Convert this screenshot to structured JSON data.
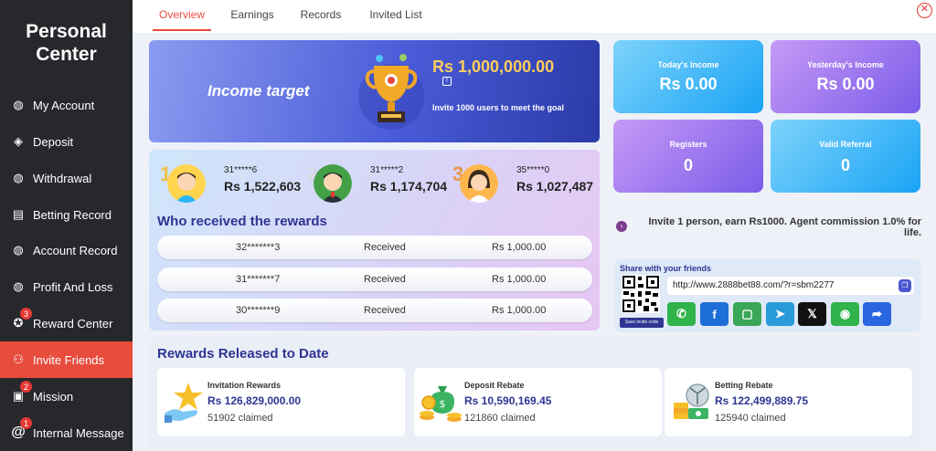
{
  "sidebar": {
    "title_line1": "Personal",
    "title_line2": "Center",
    "items": [
      {
        "label": "My Account"
      },
      {
        "label": "Deposit"
      },
      {
        "label": "Withdrawal"
      },
      {
        "label": "Betting Record"
      },
      {
        "label": "Account Record"
      },
      {
        "label": "Profit And Loss"
      },
      {
        "label": "Reward Center",
        "badge": "3"
      },
      {
        "label": "Invite Friends"
      },
      {
        "label": "Mission",
        "badge": "2"
      },
      {
        "label": "Internal Message",
        "badge": "1"
      }
    ]
  },
  "tabs": [
    "Overview",
    "Earnings",
    "Records",
    "Invited List"
  ],
  "income_target": {
    "label": "Income target",
    "amount": "Rs  1,000,000.00",
    "badge": "!",
    "description": "Invite 1000 users to meet the goal"
  },
  "stats": {
    "today": {
      "label": "Today's Income",
      "value": "Rs  0.00"
    },
    "yesterday": {
      "label": "Yesterday's Income",
      "value": "Rs  0.00"
    },
    "registers": {
      "label": "Registers",
      "value": "0"
    },
    "valid_referral": {
      "label": "Valid Referral",
      "value": "0"
    }
  },
  "leaderboard": [
    {
      "rank": "1",
      "user": "31*****6",
      "amount": "Rs 1,522,603"
    },
    {
      "rank": "2",
      "user": "31*****2",
      "amount": "Rs 1,174,704"
    },
    {
      "rank": "3",
      "user": "35*****0",
      "amount": "Rs 1,027,487"
    }
  ],
  "who_received": {
    "title": "Who received the rewards",
    "rows": [
      {
        "user": "32*******3",
        "status": "Received",
        "amount": "Rs  1,000.00"
      },
      {
        "user": "31*******7",
        "status": "Received",
        "amount": "Rs  1,000.00"
      },
      {
        "user": "30*******9",
        "status": "Received",
        "amount": "Rs  1,000.00"
      }
    ]
  },
  "invite_text": "Invite 1 person, earn Rs1000. Agent commission 1.0% for life.",
  "share": {
    "title": "Share with your friends",
    "url": "http://www.2888bet88.com/?r=sbm2277",
    "qr_button": "Save invite code",
    "socials": [
      {
        "name": "whatsapp-icon",
        "glyph": "✆",
        "color": "#2fb34a"
      },
      {
        "name": "facebook-icon",
        "glyph": "f",
        "color": "#1e6ed8"
      },
      {
        "name": "sms-icon",
        "glyph": "▢",
        "color": "#3aa657"
      },
      {
        "name": "telegram-icon",
        "glyph": "➤",
        "color": "#2a9bd9"
      },
      {
        "name": "x-icon",
        "glyph": "𝕏",
        "color": "#111111"
      },
      {
        "name": "line-icon",
        "glyph": "◉",
        "color": "#2fb34a"
      },
      {
        "name": "share-icon",
        "glyph": "➦",
        "color": "#2a66e0"
      }
    ]
  },
  "released": {
    "title": "Rewards Released to Date",
    "cards": [
      {
        "label": "Invitation Rewards",
        "amount": "Rs  126,829,000.00",
        "claimed": "51902 claimed"
      },
      {
        "label": "Deposit Rebate",
        "amount": "Rs  10,590,169.45",
        "claimed": "121860 claimed"
      },
      {
        "label": "Betting Rebate",
        "amount": "Rs  122,499,889.75",
        "claimed": "125940 claimed"
      }
    ]
  },
  "colors": {
    "accent": "#e84c3d",
    "sidebar": "#26282c",
    "navy": "#2e3592"
  }
}
